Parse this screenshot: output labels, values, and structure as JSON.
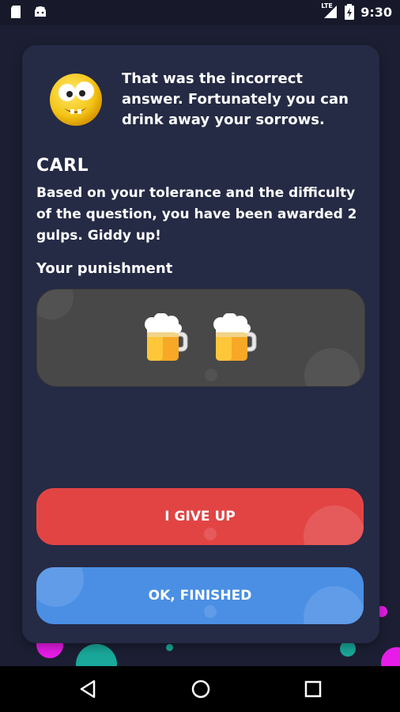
{
  "status_bar": {
    "time": "9:30",
    "network": "LTE",
    "battery_level": "charging"
  },
  "message": {
    "text": "That was the incorrect answer. Fortunately you can drink away your sorrows.",
    "emoji": "dizzy-face-icon"
  },
  "player": {
    "name": "CARL",
    "description": "Based on your tolerance and the difficulty of the question, you have been awarded 2 gulps. Giddy up!"
  },
  "punishment": {
    "label": "Your punishment",
    "beer_count": 2,
    "icon": "beer-mug-icon"
  },
  "buttons": {
    "give_up": "I GIVE UP",
    "ok_finished": "OK, FINISHED"
  },
  "colors": {
    "background": "#1c1f33",
    "card": "#252a45",
    "give_up": "#e24444",
    "ok": "#4a8fe4",
    "accent_magenta": "#e81ce8",
    "accent_teal": "#19a89a"
  }
}
